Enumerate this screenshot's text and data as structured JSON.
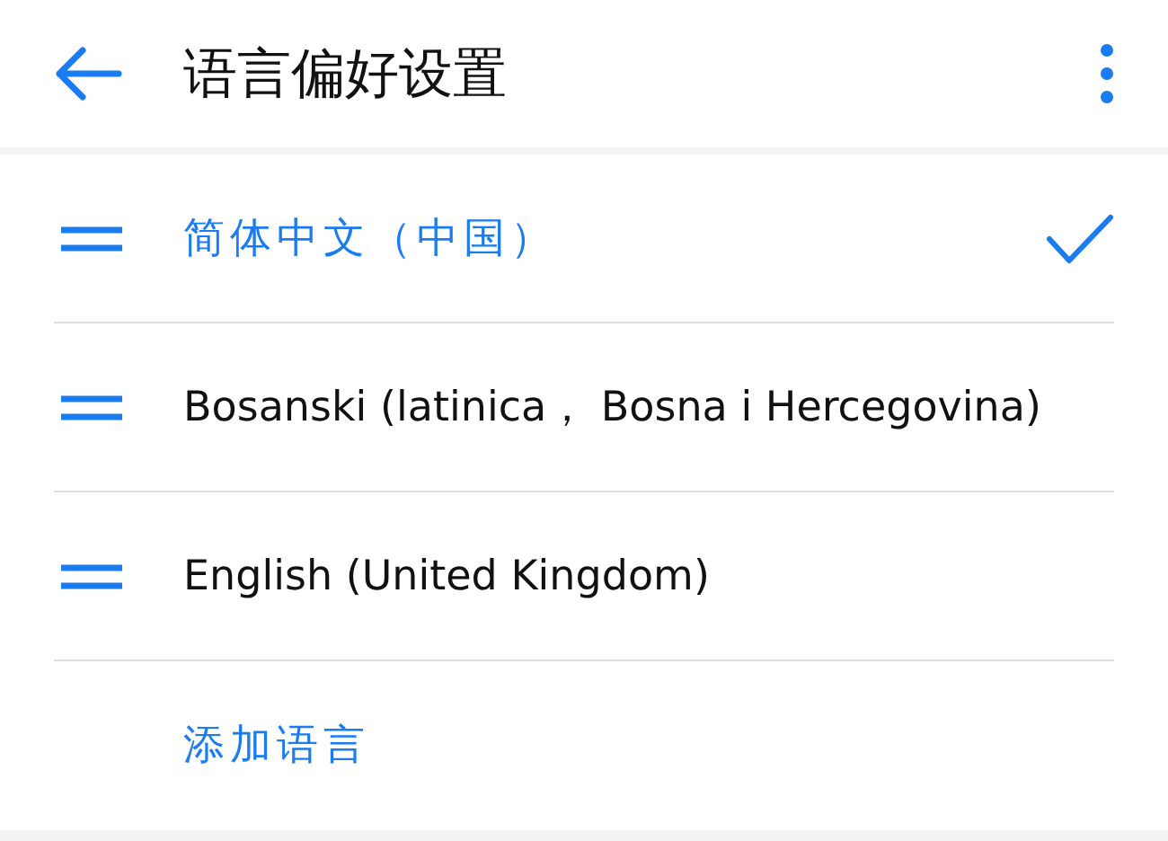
{
  "header": {
    "title": "语言偏好设置"
  },
  "languages": [
    {
      "label": "简体中文（中国）",
      "selected": true
    },
    {
      "label": "Bosanski (latinica， Bosna i Hercegovina)",
      "selected": false
    },
    {
      "label": "English (United Kingdom)",
      "selected": false
    }
  ],
  "add_language": {
    "label": "添加语言"
  }
}
